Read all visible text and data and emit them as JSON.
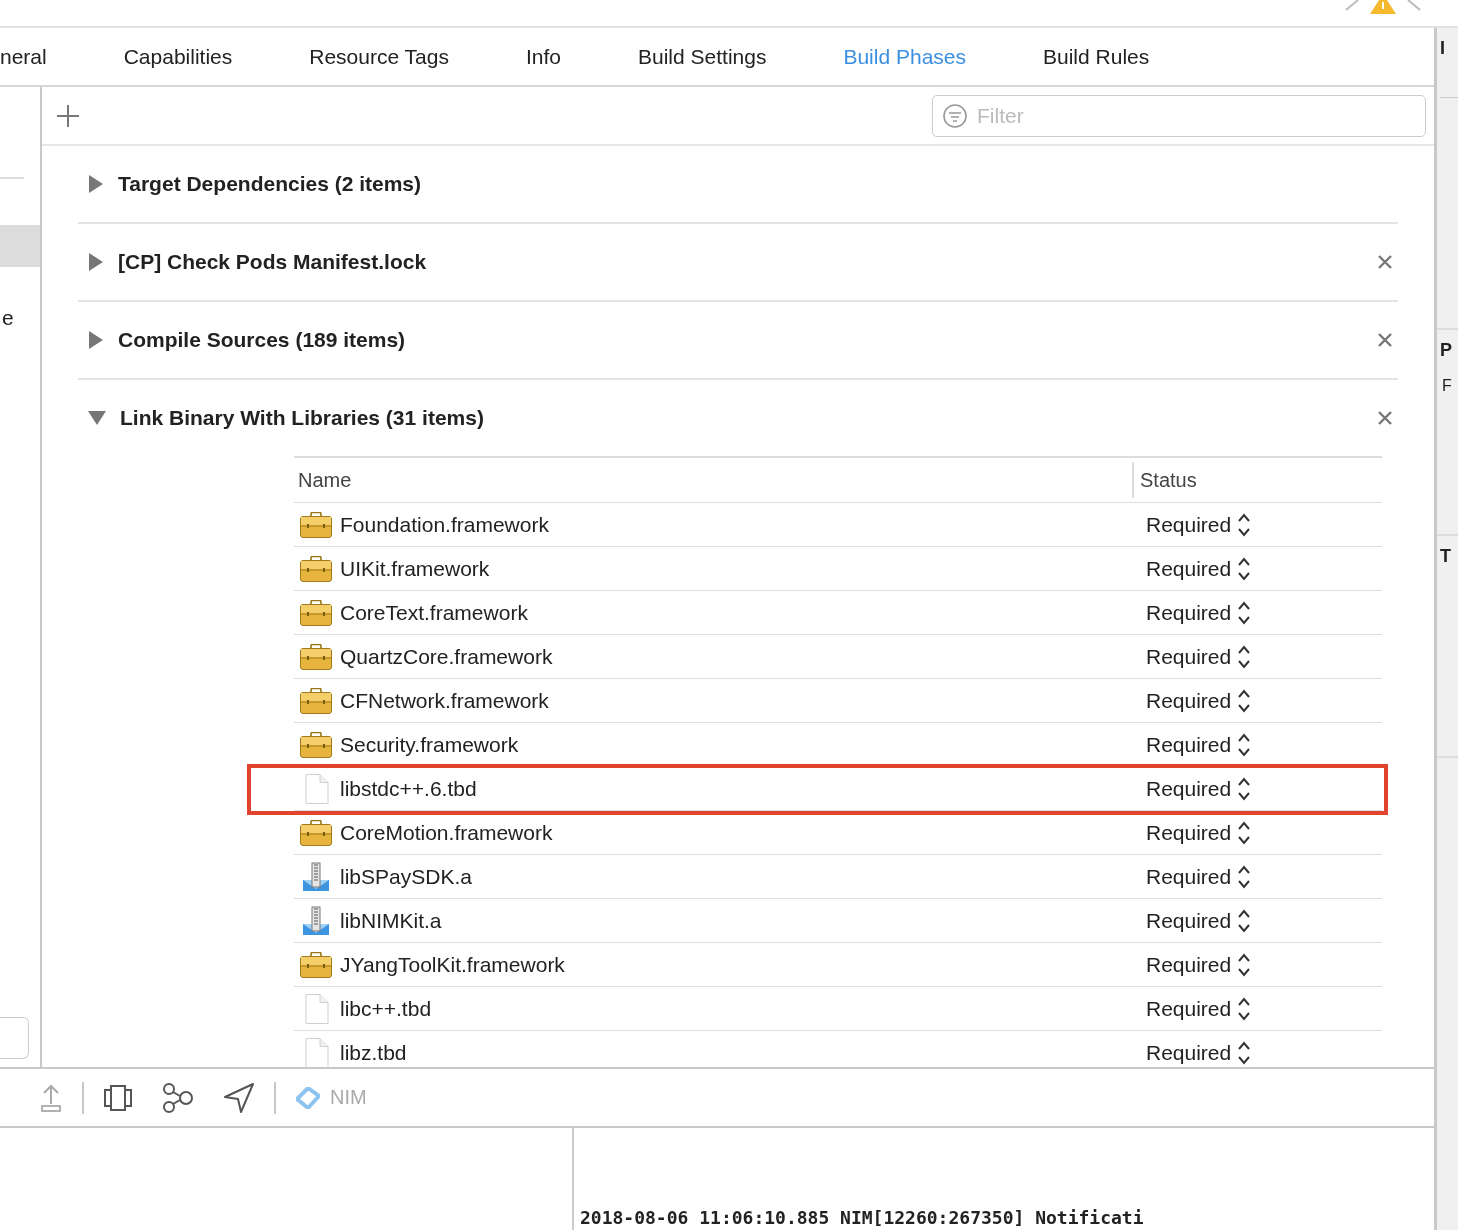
{
  "tabs": [
    {
      "label": "neral",
      "selected": false
    },
    {
      "label": "Capabilities",
      "selected": false
    },
    {
      "label": "Resource Tags",
      "selected": false
    },
    {
      "label": "Info",
      "selected": false
    },
    {
      "label": "Build Settings",
      "selected": false
    },
    {
      "label": "Build Phases",
      "selected": true
    },
    {
      "label": "Build Rules",
      "selected": false
    }
  ],
  "sidebar": {
    "items": [
      {
        "selected": true
      },
      {
        "label": "e",
        "selected": false
      }
    ]
  },
  "filter": {
    "placeholder": "Filter"
  },
  "phases": [
    {
      "title": "Target Dependencies (2 items)",
      "expanded": false,
      "removable": false
    },
    {
      "title": "[CP] Check Pods Manifest.lock",
      "expanded": false,
      "removable": true
    },
    {
      "title": "Compile Sources (189 items)",
      "expanded": false,
      "removable": true
    },
    {
      "title": "Link Binary With Libraries (31 items)",
      "expanded": true,
      "removable": true,
      "table": {
        "columns": [
          "Name",
          "Status"
        ],
        "rows": [
          {
            "name": "Foundation.framework",
            "kind": "framework",
            "status": "Required",
            "highlighted": false
          },
          {
            "name": "UIKit.framework",
            "kind": "framework",
            "status": "Required",
            "highlighted": false
          },
          {
            "name": "CoreText.framework",
            "kind": "framework",
            "status": "Required",
            "highlighted": false
          },
          {
            "name": "QuartzCore.framework",
            "kind": "framework",
            "status": "Required",
            "highlighted": false
          },
          {
            "name": "CFNetwork.framework",
            "kind": "framework",
            "status": "Required",
            "highlighted": false
          },
          {
            "name": "Security.framework",
            "kind": "framework",
            "status": "Required",
            "highlighted": false
          },
          {
            "name": "libstdc++.6.tbd",
            "kind": "file",
            "status": "Required",
            "highlighted": true
          },
          {
            "name": "CoreMotion.framework",
            "kind": "framework",
            "status": "Required",
            "highlighted": false
          },
          {
            "name": "libSPaySDK.a",
            "kind": "archive",
            "status": "Required",
            "highlighted": false
          },
          {
            "name": "libNIMKit.a",
            "kind": "archive",
            "status": "Required",
            "highlighted": false
          },
          {
            "name": "JYangToolKit.framework",
            "kind": "framework",
            "status": "Required",
            "highlighted": false
          },
          {
            "name": "libc++.tbd",
            "kind": "file",
            "status": "Required",
            "highlighted": false
          },
          {
            "name": "libz.tbd",
            "kind": "file",
            "status": "Required",
            "highlighted": false
          }
        ]
      }
    }
  ],
  "debug_bar": {
    "scheme_label": "NIM"
  },
  "console": {
    "line": "2018-08-06 11:06:10.885 NIM[12260:267350] Notificati"
  },
  "inspector": {
    "headings": [
      "I",
      "P",
      "F",
      "T"
    ]
  }
}
